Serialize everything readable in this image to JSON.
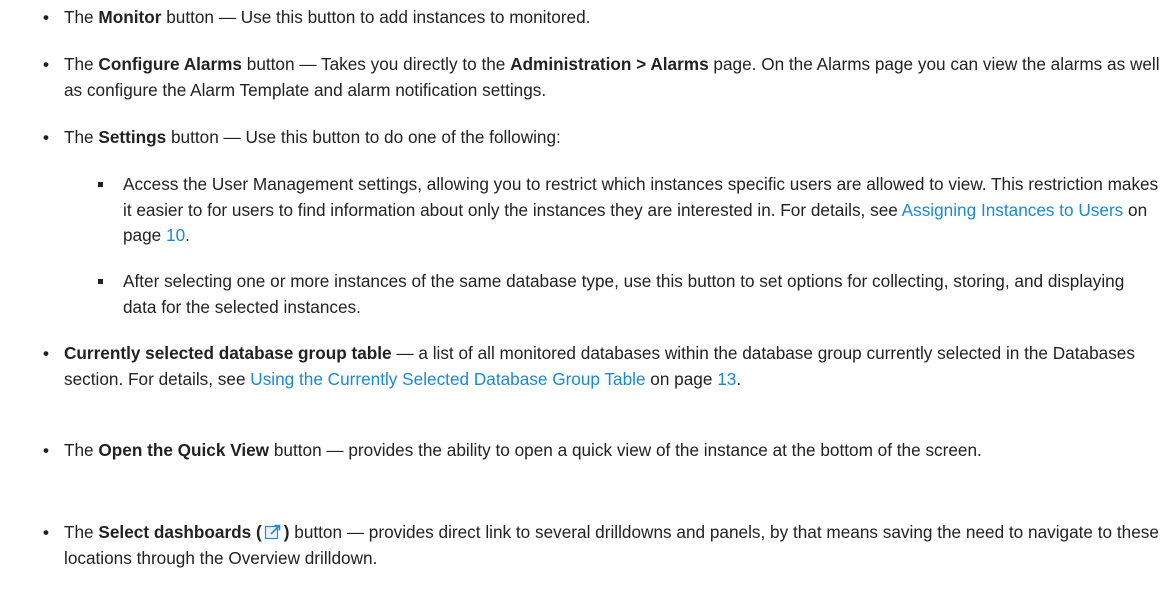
{
  "items": [
    {
      "bold": "Monitor",
      "pre": "The ",
      "post": " button — Use this button to add instances to monitored."
    },
    {
      "pre": "The ",
      "bold": "Configure Alarms",
      "mid": " button — Takes you directly to the ",
      "bold2": "Administration > Alarms",
      "post": " page. On the Alarms page you can view the alarms as well as configure the Alarm Template and alarm notification settings."
    },
    {
      "pre": "The ",
      "bold": "Settings",
      "post": " button — Use this button to do one of the following:"
    },
    {
      "text": "Access the User Management settings, allowing you to restrict which instances specific users are allowed to view. This restriction makes it easier to for users to find information about only the instances they are interested in. For details, see ",
      "link": "Assigning Instances to Users",
      "mid": " on page ",
      "page": "10",
      "end": "."
    },
    {
      "text": "After selecting one or more instances of the same database type, use this button to set options for collecting, storing, and displaying data for the selected instances."
    },
    {
      "bold": "Currently selected database group table",
      "post": " — a list of all monitored databases within the database group currently selected in the Databases section. For details, see ",
      "link": "Using the Currently Selected Database Group Table",
      "mid": " on page ",
      "page": "13",
      "end": "."
    },
    {
      "pre": "The ",
      "bold": "Open the Quick View",
      "post": " button — provides the ability to open a quick view of the instance at the bottom of the screen."
    },
    {
      "pre": "The ",
      "bold": "Select dashboards (",
      "icon": "external-link-icon",
      "bold2": ")",
      "post": " button — provides direct link to several drilldowns and panels, by that means saving the need to navigate to these locations through the Overview drilldown."
    }
  ],
  "bullet_glyph": "•",
  "colors": {
    "text": "#222222",
    "link": "#1a8ad4"
  }
}
